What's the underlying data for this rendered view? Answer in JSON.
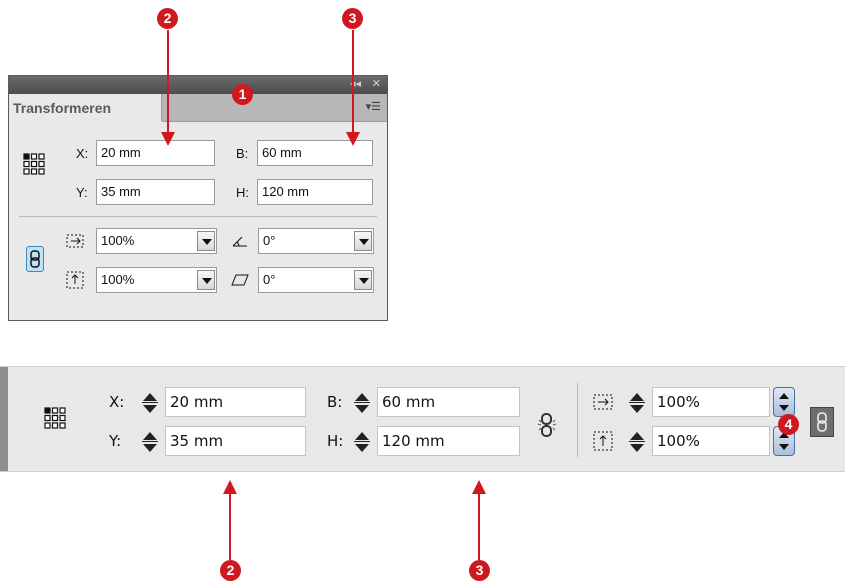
{
  "colors": {
    "marker": "#d0181f",
    "panel_bg": "#e9e9e9",
    "bar_bg": "#e8e8e8",
    "link_active": "#7fc3e8"
  },
  "markers": {
    "m1": "1",
    "m2": "2",
    "m3": "3",
    "m4": "4"
  },
  "panel": {
    "title": "Transformeren",
    "x_label": "X:",
    "x_value": "20 mm",
    "y_label": "Y:",
    "y_value": "35 mm",
    "w_label": "B:",
    "w_value": "60 mm",
    "h_label": "H:",
    "h_value": "120 mm",
    "scale_x": "100%",
    "scale_y": "100%",
    "rotation": "0°",
    "shear": "0°",
    "icons": [
      "reference-point-icon",
      "constrain-proportions-icon",
      "scale-x-icon",
      "scale-y-icon",
      "rotate-icon",
      "shear-icon",
      "collapse-icon",
      "close-icon",
      "panel-menu-icon"
    ]
  },
  "control_bar": {
    "x_label": "X:",
    "x_value": "20 mm",
    "y_label": "Y:",
    "y_value": "35 mm",
    "w_label": "B:",
    "w_value": "60 mm",
    "h_label": "H:",
    "h_value": "120 mm",
    "scale_x": "100%",
    "scale_y": "100%",
    "icons": [
      "reference-point-icon",
      "constrain-proportions-icon",
      "scale-x-icon",
      "scale-y-icon",
      "link-icon",
      "spinner-icon",
      "stepper-icon"
    ]
  }
}
